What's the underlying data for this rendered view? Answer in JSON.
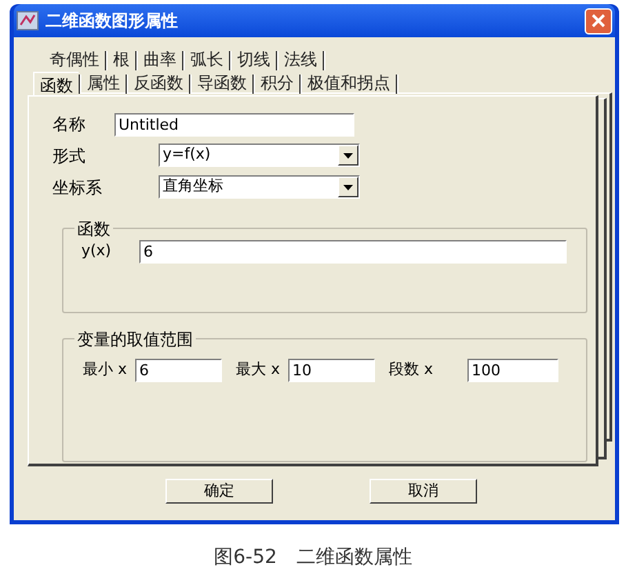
{
  "window": {
    "title": "二维函数图形属性"
  },
  "tab_rows": [
    [
      {
        "label": "奇偶性",
        "selected": false
      },
      {
        "label": "根",
        "selected": false
      },
      {
        "label": "曲率",
        "selected": false
      },
      {
        "label": "弧长",
        "selected": false
      },
      {
        "label": "切线",
        "selected": false
      },
      {
        "label": "法线",
        "selected": false
      }
    ],
    [
      {
        "label": "函数",
        "selected": true
      },
      {
        "label": "属性",
        "selected": false
      },
      {
        "label": "反函数",
        "selected": false
      },
      {
        "label": "导函数",
        "selected": false
      },
      {
        "label": "积分",
        "selected": false
      },
      {
        "label": "极值和拐点",
        "selected": false
      }
    ]
  ],
  "name_field": {
    "label": "名称",
    "value": "Untitled"
  },
  "form_select": {
    "label": "形式",
    "value": "y=f(x)"
  },
  "coord_select": {
    "label": "坐标系",
    "value": "直角坐标"
  },
  "function_group": {
    "title": "函数",
    "label": "y(x)",
    "value": "6"
  },
  "range_group": {
    "title": "变量的取值范围",
    "fields": [
      {
        "label": "最小 x",
        "value": "6"
      },
      {
        "label": "最大 x",
        "value": "10"
      },
      {
        "label": "段数 x",
        "value": "100"
      }
    ]
  },
  "buttons": [
    "确定",
    "取消"
  ],
  "caption": "图6-52　二维函数属性"
}
